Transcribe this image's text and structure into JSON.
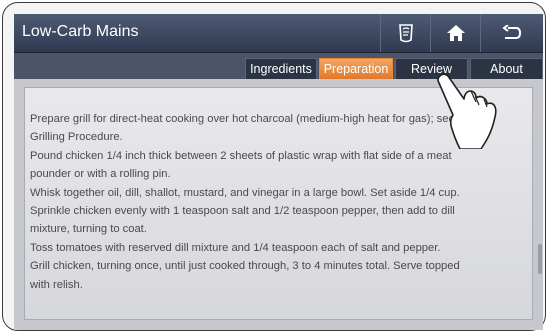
{
  "window": {
    "title": "Low-Carb Mains"
  },
  "toolbar": {
    "recipe_icon": "recipe-card-icon",
    "home_icon": "home-icon",
    "back_icon": "back-arrow-icon"
  },
  "tabs": [
    {
      "label": "Ingredients",
      "active": false
    },
    {
      "label": "Preparation",
      "active": true
    },
    {
      "label": "Review",
      "active": false
    },
    {
      "label": "About",
      "active": false
    }
  ],
  "content": {
    "lines": [
      "Prepare grill for direct-heat cooking over hot charcoal (medium-high heat for gas); see",
      "Grilling Procedure.",
      "Pound chicken 1/4 inch thick between 2 sheets of plastic wrap with flat side of a meat",
      "pounder or with a rolling pin.",
      "Whisk together oil, dill, shallot, mustard, and vinegar in a large bowl. Set aside 1/4 cup.",
      "Sprinkle chicken evenly with 1 teaspoon salt and 1/2 teaspoon pepper, then add to dill",
      "mixture, turning to coat.",
      "Toss tomatoes with reserved dill mixture and 1/4 teaspoon each of salt and pepper.",
      "Grill chicken, turning once, until just cooked through, 3 to 4 minutes total. Serve topped",
      "with relish."
    ]
  },
  "colors": {
    "titlebar": "#3d4860",
    "active_tab": "#e88a3c",
    "text": "#4a4a4a"
  }
}
